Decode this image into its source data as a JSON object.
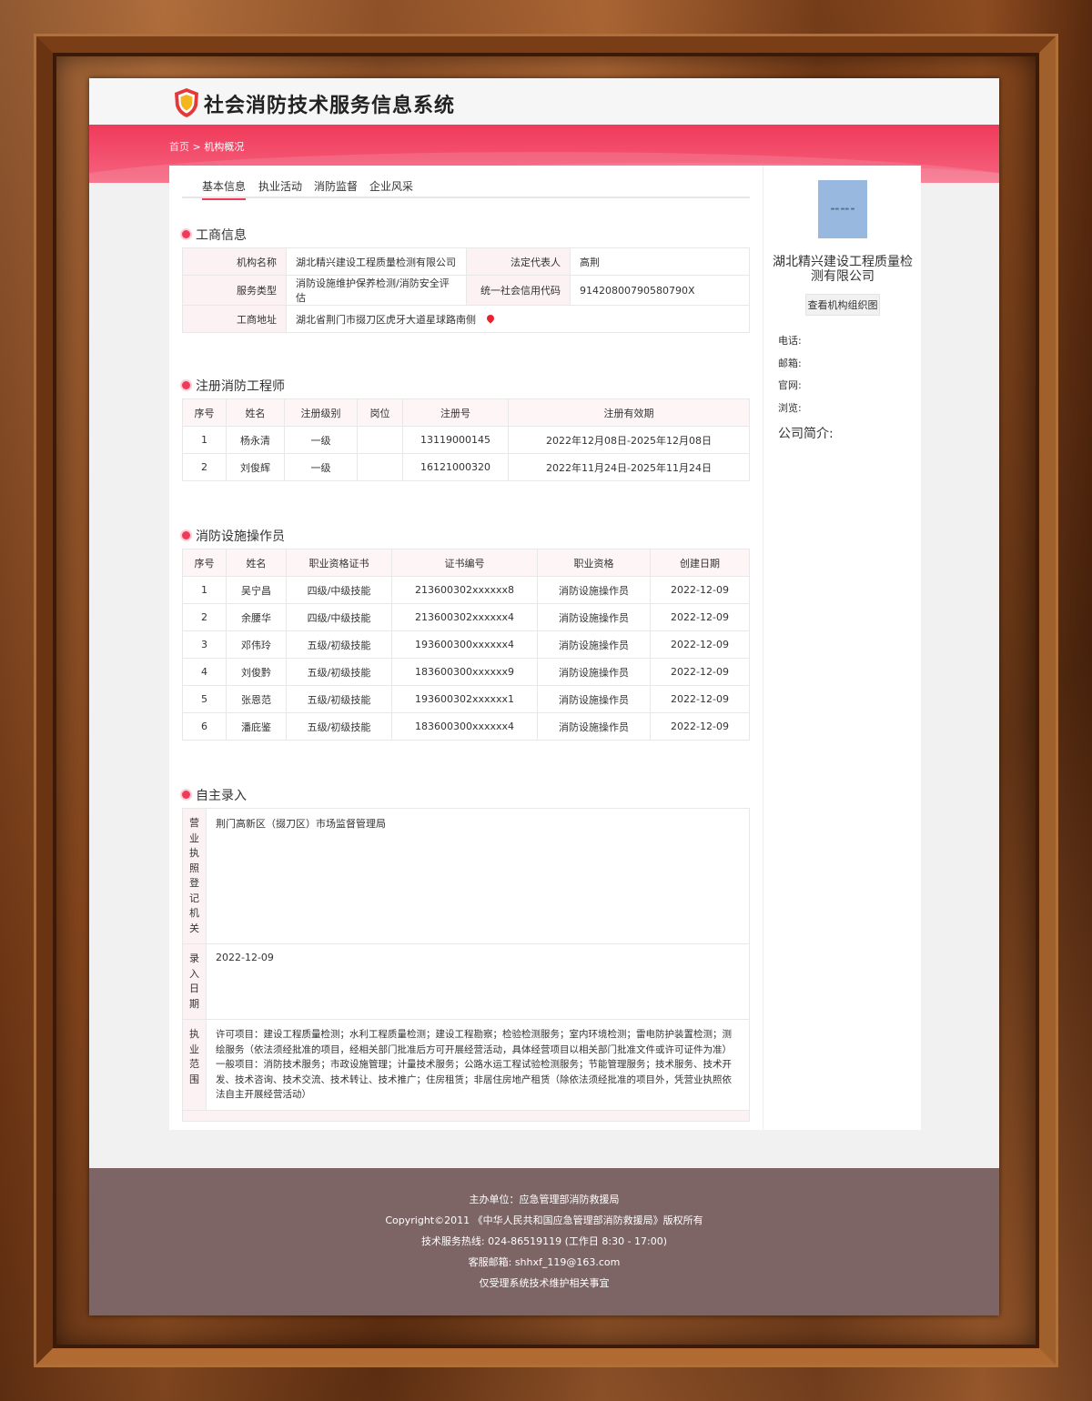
{
  "header": {
    "site_title": "社会消防技术服务信息系统"
  },
  "breadcrumb": {
    "home": "首页",
    "sep": " > ",
    "current": "机构概况"
  },
  "tabs": [
    "基本信息",
    "执业活动",
    "消防监督",
    "企业风采"
  ],
  "business_info": {
    "title": "工商信息",
    "rows": [
      {
        "l1": "机构名称",
        "v1": "湖北精兴建设工程质量检测有限公司",
        "l2": "法定代表人",
        "v2": "高荆"
      },
      {
        "l1": "服务类型",
        "v1": "消防设施维护保养检测/消防安全评估",
        "l2": "统一社会信用代码",
        "v2": "91420800790580790X"
      },
      {
        "l1": "工商地址",
        "v1": "湖北省荆门市掇刀区虎牙大道星球路南侧"
      }
    ]
  },
  "engineers": {
    "title": "注册消防工程师",
    "headers": [
      "序号",
      "姓名",
      "注册级别",
      "岗位",
      "注册号",
      "注册有效期"
    ],
    "rows": [
      [
        "1",
        "杨永清",
        "一级",
        "",
        "13119000145",
        "2022年12月08日-2025年12月08日"
      ],
      [
        "2",
        "刘俊辉",
        "一级",
        "",
        "16121000320",
        "2022年11月24日-2025年11月24日"
      ]
    ]
  },
  "operators": {
    "title": "消防设施操作员",
    "headers": [
      "序号",
      "姓名",
      "职业资格证书",
      "证书编号",
      "职业资格",
      "创建日期"
    ],
    "rows": [
      [
        "1",
        "吴宁昌",
        "四级/中级技能",
        "213600302xxxxxx8",
        "消防设施操作员",
        "2022-12-09"
      ],
      [
        "2",
        "余腰华",
        "四级/中级技能",
        "213600302xxxxxx4",
        "消防设施操作员",
        "2022-12-09"
      ],
      [
        "3",
        "邓伟玲",
        "五级/初级技能",
        "193600300xxxxxx4",
        "消防设施操作员",
        "2022-12-09"
      ],
      [
        "4",
        "刘俊黔",
        "五级/初级技能",
        "183600300xxxxxx9",
        "消防设施操作员",
        "2022-12-09"
      ],
      [
        "5",
        "张恩范",
        "五级/初级技能",
        "193600302xxxxxx1",
        "消防设施操作员",
        "2022-12-09"
      ],
      [
        "6",
        "潘庇鉴",
        "五级/初级技能",
        "183600300xxxxxx4",
        "消防设施操作员",
        "2022-12-09"
      ]
    ]
  },
  "self_entry": {
    "title": "自主录入",
    "rows": [
      {
        "label": "营业执照登记机关",
        "value": "荆门高新区（掇刀区）市场监督管理局"
      },
      {
        "label": "录入日期",
        "value": "2022-12-09"
      },
      {
        "label": "执业范围",
        "value": "许可项目：建设工程质量检测；水利工程质量检测；建设工程勘察；检验检测服务；室内环境检测；雷电防护装置检测；测绘服务（依法须经批准的项目，经相关部门批准后方可开展经营活动，具体经营项目以相关部门批准文件或许可证件为准）一般项目：消防技术服务；市政设施管理；计量技术服务；公路水运工程试验检测服务；节能管理服务；技术服务、技术开发、技术咨询、技术交流、技术转让、技术推广；住房租赁；非居住房地产租赁（除依法须经批准的项目外，凭营业执照依法自主开展经营活动）"
      }
    ]
  },
  "side": {
    "company_name": "湖北精兴建设工程质量检测有限公司",
    "org_button": "查看机构组织图",
    "phone_label": "电话:",
    "email_label": "邮箱:",
    "website_label": "官网:",
    "views_label": "浏览:",
    "intro_label": "公司简介:"
  },
  "footer": {
    "line1": "主办单位：应急管理部消防救援局",
    "line2": "Copyright©2011 《中华人民共和国应急管理部消防救援局》版权所有",
    "line3": "技术服务热线: 024-86519119 (工作日 8:30 - 17:00)",
    "line4": "客服邮箱: shhxf_119@163.com",
    "line5": "仅受理系统技术维护相关事宜"
  },
  "colors": {
    "accent": "#f03a5a",
    "footer_bg": "#7d6566",
    "frame": "#8a4a1f"
  }
}
